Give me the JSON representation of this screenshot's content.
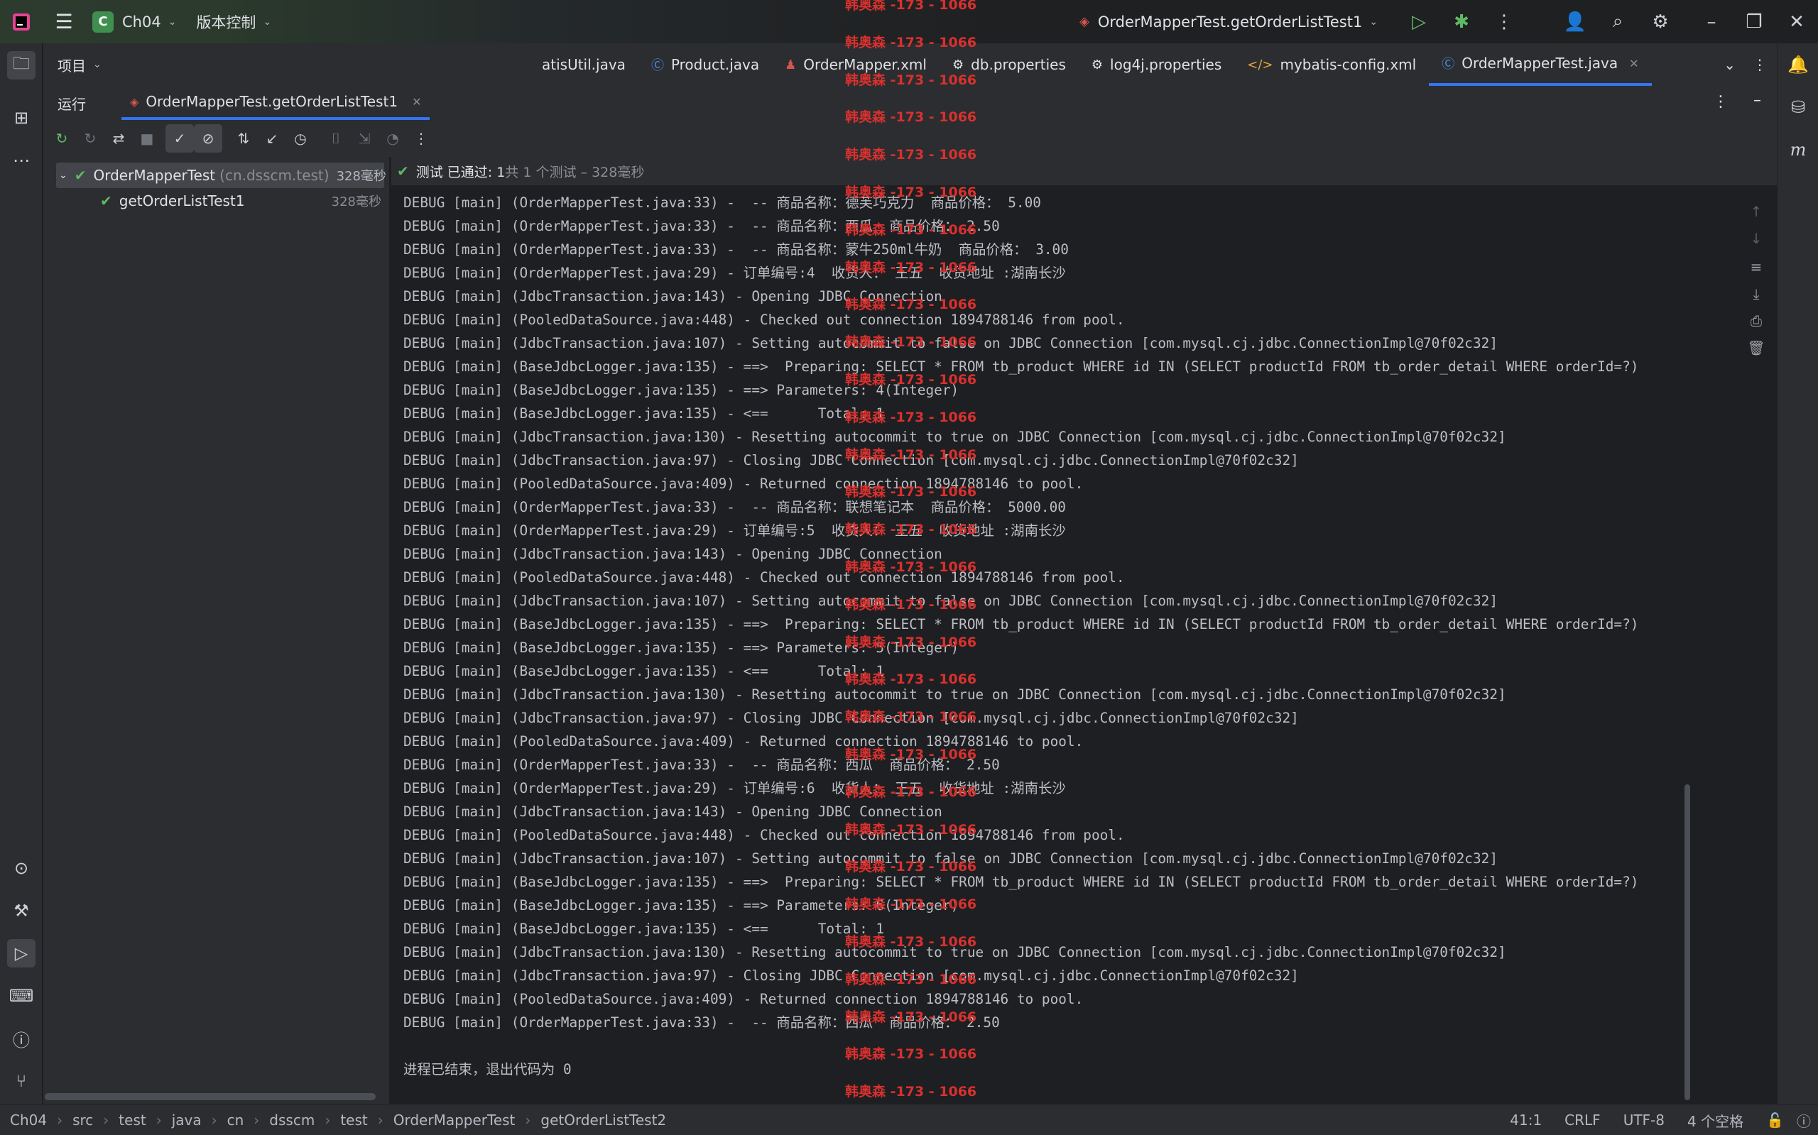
{
  "titlebar": {
    "project_badge": "C",
    "project_name": "Ch04",
    "vcs_label": "版本控制",
    "run_config": "OrderMapperTest.getOrderListTest1"
  },
  "project_panel": {
    "title": "项目"
  },
  "editor_tabs": [
    {
      "label": "atisUtil.java",
      "icon": "class-icon"
    },
    {
      "label": "Product.java",
      "icon": "class-icon"
    },
    {
      "label": "OrderMapper.xml",
      "icon": "mybatis-icon"
    },
    {
      "label": "db.properties",
      "icon": "gear-icon"
    },
    {
      "label": "log4j.properties",
      "icon": "gear-icon"
    },
    {
      "label": "mybatis-config.xml",
      "icon": "xml-icon"
    },
    {
      "label": "OrderMapperTest.java",
      "icon": "class-icon"
    }
  ],
  "run_panel": {
    "title": "运行",
    "tab_label": "OrderMapperTest.getOrderListTest1",
    "test_status": "测试 已通过: 1",
    "test_detail": "共 1 个测试 – 328毫秒"
  },
  "test_tree": {
    "root": {
      "name": "OrderMapperTest",
      "package": "(cn.dsscm.test)",
      "time": "328毫秒"
    },
    "child": {
      "name": "getOrderListTest1",
      "time": "328毫秒"
    }
  },
  "console_lines": [
    "DEBUG [main] (OrderMapperTest.java:33) -  -- 商品名称：德芙巧克力  商品价格： 5.00",
    "DEBUG [main] (OrderMapperTest.java:33) -  -- 商品名称：西瓜  商品价格： 2.50",
    "DEBUG [main] (OrderMapperTest.java:33) -  -- 商品名称：蒙牛250ml牛奶  商品价格： 3.00",
    "DEBUG [main] (OrderMapperTest.java:29) - 订单编号:4  收货人： 王五  收货地址 :湖南长沙",
    "DEBUG [main] (JdbcTransaction.java:143) - Opening JDBC Connection",
    "DEBUG [main] (PooledDataSource.java:448) - Checked out connection 1894788146 from pool.",
    "DEBUG [main] (JdbcTransaction.java:107) - Setting autocommit to false on JDBC Connection [com.mysql.cj.jdbc.ConnectionImpl@70f02c32]",
    "DEBUG [main] (BaseJdbcLogger.java:135) - ==>  Preparing: SELECT * FROM tb_product WHERE id IN (SELECT productId FROM tb_order_detail WHERE orderId=?)",
    "DEBUG [main] (BaseJdbcLogger.java:135) - ==> Parameters: 4(Integer)",
    "DEBUG [main] (BaseJdbcLogger.java:135) - <==      Total: 1",
    "DEBUG [main] (JdbcTransaction.java:130) - Resetting autocommit to true on JDBC Connection [com.mysql.cj.jdbc.ConnectionImpl@70f02c32]",
    "DEBUG [main] (JdbcTransaction.java:97) - Closing JDBC Connection [com.mysql.cj.jdbc.ConnectionImpl@70f02c32]",
    "DEBUG [main] (PooledDataSource.java:409) - Returned connection 1894788146 to pool.",
    "DEBUG [main] (OrderMapperTest.java:33) -  -- 商品名称：联想笔记本  商品价格： 5000.00",
    "DEBUG [main] (OrderMapperTest.java:29) - 订单编号:5  收货人： 王五  收货地址 :湖南长沙",
    "DEBUG [main] (JdbcTransaction.java:143) - Opening JDBC Connection",
    "DEBUG [main] (PooledDataSource.java:448) - Checked out connection 1894788146 from pool.",
    "DEBUG [main] (JdbcTransaction.java:107) - Setting autocommit to false on JDBC Connection [com.mysql.cj.jdbc.ConnectionImpl@70f02c32]",
    "DEBUG [main] (BaseJdbcLogger.java:135) - ==>  Preparing: SELECT * FROM tb_product WHERE id IN (SELECT productId FROM tb_order_detail WHERE orderId=?)",
    "DEBUG [main] (BaseJdbcLogger.java:135) - ==> Parameters: 5(Integer)",
    "DEBUG [main] (BaseJdbcLogger.java:135) - <==      Total: 1",
    "DEBUG [main] (JdbcTransaction.java:130) - Resetting autocommit to true on JDBC Connection [com.mysql.cj.jdbc.ConnectionImpl@70f02c32]",
    "DEBUG [main] (JdbcTransaction.java:97) - Closing JDBC Connection [com.mysql.cj.jdbc.ConnectionImpl@70f02c32]",
    "DEBUG [main] (PooledDataSource.java:409) - Returned connection 1894788146 to pool.",
    "DEBUG [main] (OrderMapperTest.java:33) -  -- 商品名称：西瓜  商品价格： 2.50",
    "DEBUG [main] (OrderMapperTest.java:29) - 订单编号:6  收货人： 王五  收货地址 :湖南长沙",
    "DEBUG [main] (JdbcTransaction.java:143) - Opening JDBC Connection",
    "DEBUG [main] (PooledDataSource.java:448) - Checked out connection 1894788146 from pool.",
    "DEBUG [main] (JdbcTransaction.java:107) - Setting autocommit to false on JDBC Connection [com.mysql.cj.jdbc.ConnectionImpl@70f02c32]",
    "DEBUG [main] (BaseJdbcLogger.java:135) - ==>  Preparing: SELECT * FROM tb_product WHERE id IN (SELECT productId FROM tb_order_detail WHERE orderId=?)",
    "DEBUG [main] (BaseJdbcLogger.java:135) - ==> Parameters: 6(Integer)",
    "DEBUG [main] (BaseJdbcLogger.java:135) - <==      Total: 1",
    "DEBUG [main] (JdbcTransaction.java:130) - Resetting autocommit to true on JDBC Connection [com.mysql.cj.jdbc.ConnectionImpl@70f02c32]",
    "DEBUG [main] (JdbcTransaction.java:97) - Closing JDBC Connection [com.mysql.cj.jdbc.ConnectionImpl@70f02c32]",
    "DEBUG [main] (PooledDataSource.java:409) - Returned connection 1894788146 to pool.",
    "DEBUG [main] (OrderMapperTest.java:33) -  -- 商品名称：西瓜  商品价格： 2.50",
    "",
    "进程已结束，退出代码为 0"
  ],
  "watermark_text": "韩奥森 -173 - 1066",
  "breadcrumbs": [
    "Ch04",
    "src",
    "test",
    "java",
    "cn",
    "dsscm",
    "test",
    "OrderMapperTest",
    "getOrderListTest2"
  ],
  "status": {
    "position": "41:1",
    "line_sep": "CRLF",
    "encoding": "UTF-8",
    "indent": "4 个空格"
  },
  "colors": {
    "accent": "#3574f0",
    "pass": "#5fb865",
    "watermark": "#d8312e"
  }
}
